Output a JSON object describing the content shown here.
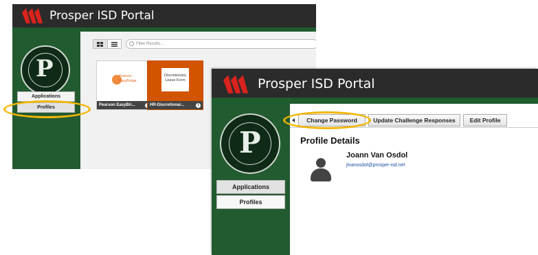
{
  "portal": {
    "title": "Prosper ISD Portal",
    "brand_colors": {
      "header": "#2b2b2b",
      "sidebar": "#235b31",
      "logo_red": "#d9231c",
      "highlight": "#f2b705"
    },
    "seal_letter": "P"
  },
  "back_window": {
    "sidebar": {
      "items": [
        {
          "label": "Applications"
        },
        {
          "label": "Profiles"
        }
      ]
    },
    "search": {
      "placeholder": "Filter Results..."
    },
    "view_icons": [
      "grid-view-icon",
      "list-view-icon"
    ],
    "tiles": [
      {
        "label": "Pearson EasyBri...",
        "logo_text": "Pearson EasyBridge",
        "icon": "info-icon"
      },
      {
        "label": "HR-Discretionar...",
        "logo_text": "Discretionary Leave Form",
        "icon": "info-icon"
      }
    ]
  },
  "front_window": {
    "sidebar": {
      "items": [
        {
          "label": "Applications"
        },
        {
          "label": "Profiles"
        }
      ]
    },
    "toolbar": {
      "change_password": "Change Password",
      "update_challenge": "Update Challenge Responses",
      "edit_profile": "Edit Profile"
    },
    "profile": {
      "section_title": "Profile Details",
      "name": "Joann Van Osdol",
      "email": "jtvanosdol@prosper-isd.net",
      "avatar_icon": "user-avatar-icon"
    }
  }
}
